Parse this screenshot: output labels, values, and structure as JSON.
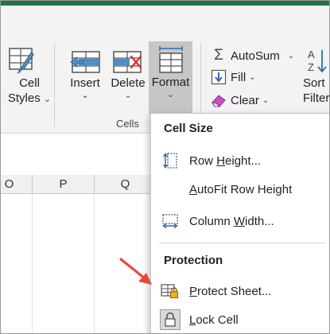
{
  "ribbon": {
    "styles": {
      "cell_styles_line1": "Cell",
      "cell_styles_line2": "Styles"
    },
    "cells_group": {
      "insert_label": "Insert",
      "delete_label": "Delete",
      "format_label": "Format",
      "group_label": "Cells"
    },
    "editing": {
      "autosum_label": "AutoSum",
      "fill_label": "Fill",
      "clear_label": "Clear",
      "sort_line1": "Sort",
      "sort_line2": "Filter"
    }
  },
  "sheet": {
    "columns": [
      "O",
      "P",
      "Q"
    ]
  },
  "format_menu": {
    "cell_size_heading": "Cell Size",
    "row_height": {
      "pre": "Row ",
      "key": "H",
      "post": "eight..."
    },
    "autofit_row_height": {
      "pre": "",
      "key": "A",
      "post": "utoFit Row Height"
    },
    "column_width": {
      "pre": "Column ",
      "key": "W",
      "post": "idth..."
    },
    "protection_heading": "Protection",
    "protect_sheet": {
      "pre": "",
      "key": "P",
      "post": "rotect Sheet..."
    },
    "lock_cell": {
      "pre": "",
      "key": "L",
      "post": "ock Cell"
    }
  },
  "colors": {
    "accent_green": "#217346",
    "format_selected_bg": "#c6c6c6",
    "annotation_arrow": "#e8473b"
  }
}
